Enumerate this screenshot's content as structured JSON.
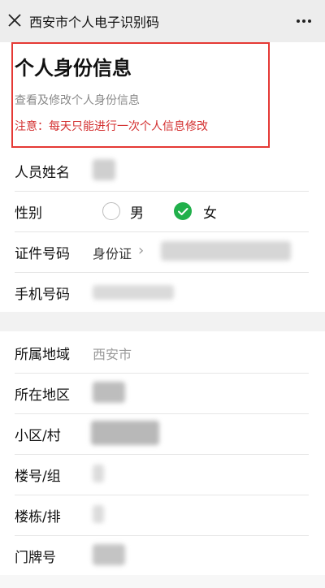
{
  "topbar": {
    "title": "西安市个人电子识别码",
    "close_icon": "close-icon",
    "more_icon": "more-icon"
  },
  "header": {
    "title": "个人身份信息",
    "subtitle": "查看及修改个人身份信息",
    "notice": "注意：每天只能进行一次个人信息修改"
  },
  "personal": {
    "name_label": "人员姓名",
    "gender_label": "性别",
    "gender_options": [
      "男",
      "女"
    ],
    "gender_selected": "女",
    "id_label": "证件号码",
    "id_type": "身份证",
    "id_type_arrow": "›",
    "phone_label": "手机号码"
  },
  "address": {
    "region_label": "所属地域",
    "region_value": "西安市",
    "area_label": "所在地区",
    "community_label": "小区/村",
    "building_label": "楼号/组",
    "unit_label": "楼栋/排",
    "door_label": "门牌号"
  },
  "colors": {
    "accent_green": "#21b04b",
    "notice_red": "#d32f2f",
    "highlight_red": "#e53935"
  }
}
